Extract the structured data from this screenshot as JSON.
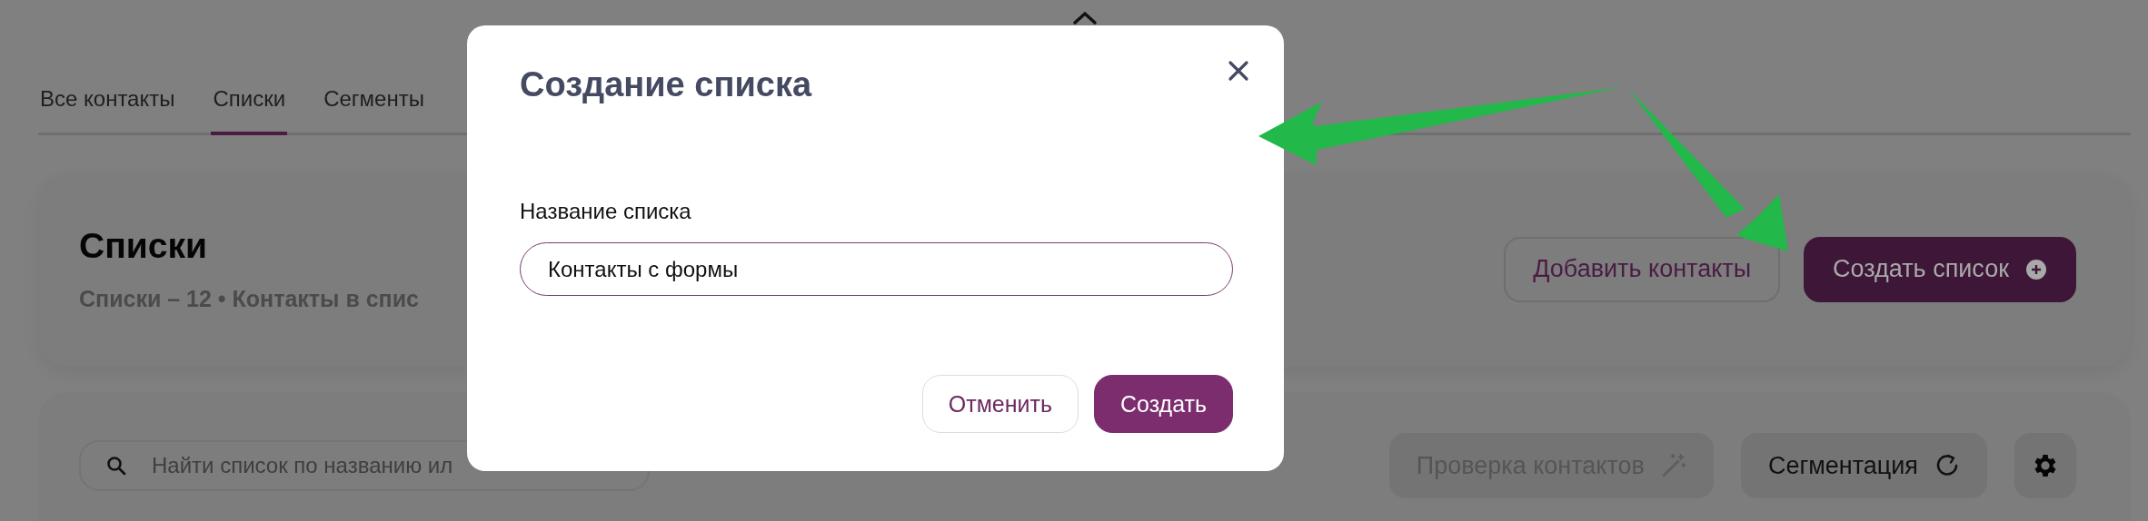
{
  "tabs": [
    {
      "label": "Все контакты",
      "selected": false
    },
    {
      "label": "Списки",
      "selected": true
    },
    {
      "label": "Сегменты",
      "selected": false
    }
  ],
  "header": {
    "title": "Списки",
    "subtitle": "Списки – 12 • Контакты в спис",
    "buttons": [
      {
        "label": "Добавить контакты",
        "kind": "outline"
      },
      {
        "label": "Создать список",
        "kind": "primary"
      }
    ]
  },
  "toolbar": {
    "search": {
      "placeholder": "Найти список по названию ил"
    },
    "buttons": [
      {
        "label": "Проверка контактов",
        "kind": "wand",
        "disabled": true
      },
      {
        "label": "Сегментация",
        "kind": "refresh",
        "disabled": false
      },
      {
        "kind": "settings"
      }
    ]
  },
  "dialog": {
    "title": "Создание списка",
    "field": {
      "label": "Название списка",
      "value": "Контакты с формы"
    },
    "buttons": [
      {
        "label": "Отменить",
        "kind": "outline"
      },
      {
        "label": "Создать",
        "kind": "primary"
      }
    ]
  }
}
